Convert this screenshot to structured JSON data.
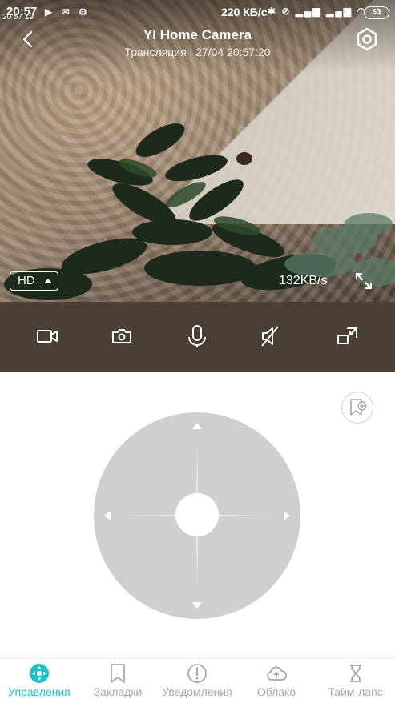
{
  "status_bar": {
    "time": "20:57",
    "time_small": "20 57 19",
    "speed": "220 КБ/с",
    "battery": "63"
  },
  "header": {
    "title": "YI Home Camera",
    "subtitle": "Трансляция | 27/04 20:57:20"
  },
  "video": {
    "quality": "HD",
    "bitrate": "132KB/s"
  },
  "toolbar": {
    "icons": [
      "video-record-icon",
      "camera-snapshot-icon",
      "microphone-icon",
      "sound-off-icon",
      "picture-in-picture-icon"
    ]
  },
  "colors": {
    "accent": "#22bfc7",
    "toolbar_bg": "#4a3f34",
    "joystick": "#cfcfcf",
    "inactive": "#a7a7a7"
  },
  "bottom_nav": {
    "items": [
      {
        "label": "Управления",
        "icon": "control-icon",
        "active": true
      },
      {
        "label": "Закладки",
        "icon": "bookmark-icon",
        "active": false
      },
      {
        "label": "Уведомления",
        "icon": "alert-icon",
        "active": false
      },
      {
        "label": "Облако",
        "icon": "cloud-upload-icon",
        "active": false
      },
      {
        "label": "Тайм-лапс",
        "icon": "hourglass-icon",
        "active": false
      }
    ]
  }
}
